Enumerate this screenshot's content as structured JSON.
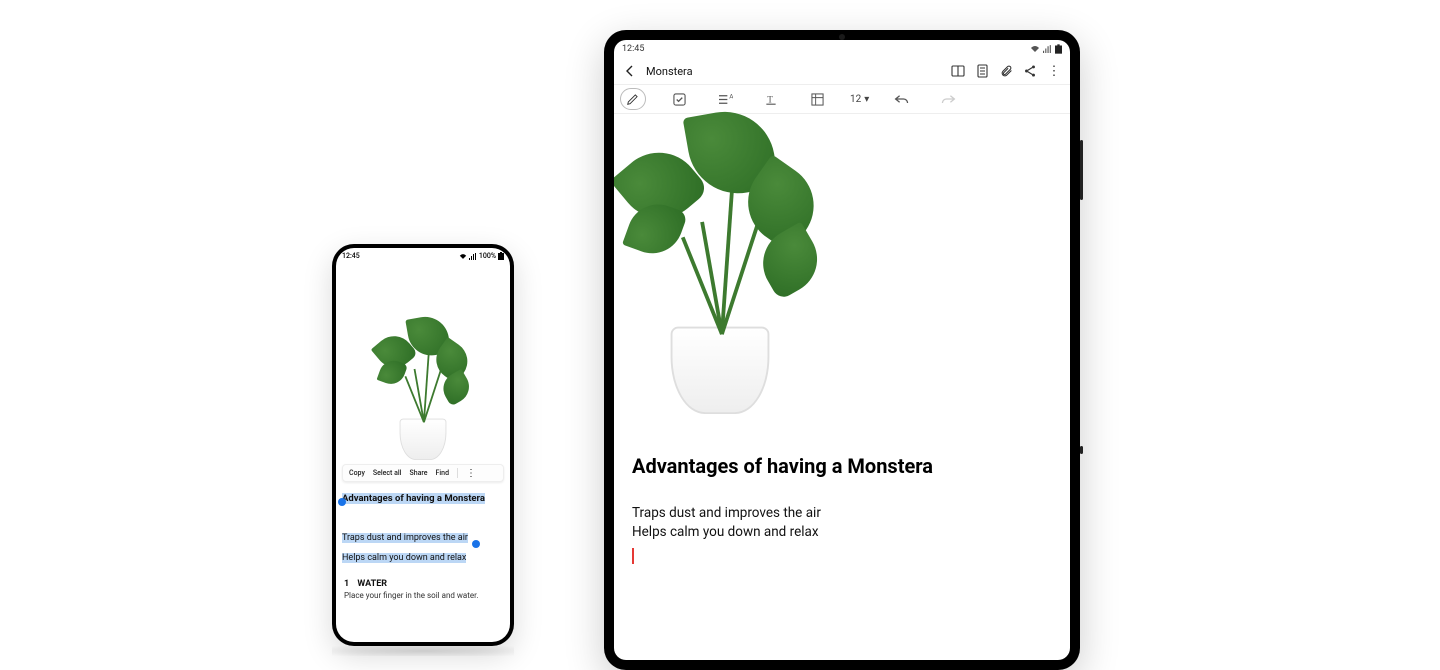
{
  "phone": {
    "status": {
      "time": "12:45",
      "battery": "100%"
    },
    "context_menu": {
      "copy": "Copy",
      "select_all": "Select all",
      "share": "Share",
      "find": "Find"
    },
    "selection": {
      "title": "Advantages of having a Monstera",
      "line1": "Traps dust and improves the air",
      "line2": "Helps calm you down and relax"
    },
    "section": {
      "number": "1",
      "label": "WATER",
      "body": "Place your finger in the soil and water."
    }
  },
  "tablet": {
    "status": {
      "time": "12:45"
    },
    "titlebar": {
      "title": "Monstera"
    },
    "toolbar": {
      "font_size": "12"
    },
    "note": {
      "title": "Advantages of having a Monstera",
      "line1": "Traps dust and improves the air",
      "line2": "Helps calm you down and relax"
    }
  }
}
